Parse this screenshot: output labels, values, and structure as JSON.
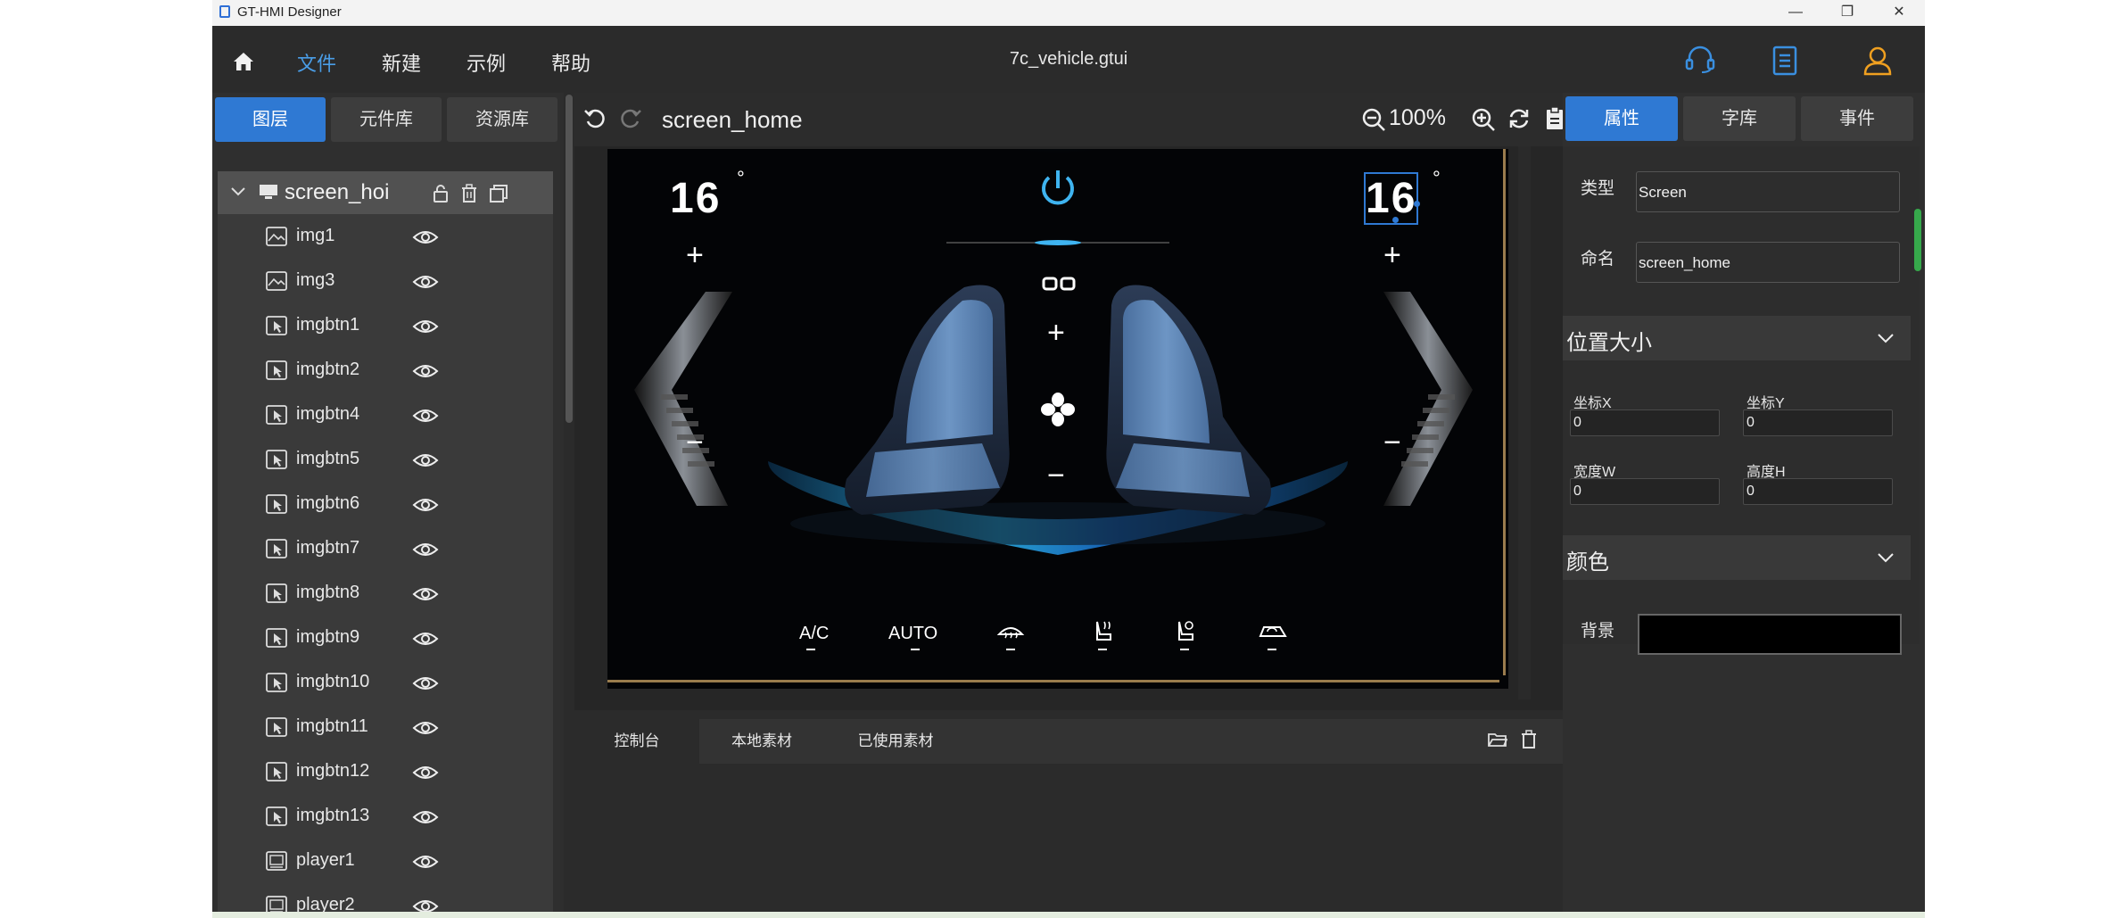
{
  "window": {
    "title": "GT-HMI Designer",
    "minimize": "—",
    "maximize": "❐",
    "close": "✕"
  },
  "menubar": {
    "home_icon": "home-icon",
    "items": [
      "文件",
      "新建",
      "示例",
      "帮助"
    ],
    "active_item": "文件",
    "filename": "7c_vehicle.gtui",
    "right_icons": [
      "headset-icon",
      "document-icon",
      "user-icon"
    ],
    "accent_color": "#4a9de6"
  },
  "left_panel": {
    "tabs": [
      "图层",
      "元件库",
      "资源库"
    ],
    "active_tab": "图层",
    "root_layer": "screen_hoi",
    "layers": [
      {
        "name": "img1",
        "type": "image"
      },
      {
        "name": "img3",
        "type": "image"
      },
      {
        "name": "imgbtn1",
        "type": "image-button"
      },
      {
        "name": "imgbtn2",
        "type": "image-button"
      },
      {
        "name": "imgbtn4",
        "type": "image-button"
      },
      {
        "name": "imgbtn5",
        "type": "image-button"
      },
      {
        "name": "imgbtn6",
        "type": "image-button"
      },
      {
        "name": "imgbtn7",
        "type": "image-button"
      },
      {
        "name": "imgbtn8",
        "type": "image-button"
      },
      {
        "name": "imgbtn9",
        "type": "image-button"
      },
      {
        "name": "imgbtn10",
        "type": "image-button"
      },
      {
        "name": "imgbtn11",
        "type": "image-button"
      },
      {
        "name": "imgbtn12",
        "type": "image-button"
      },
      {
        "name": "imgbtn13",
        "type": "image-button"
      },
      {
        "name": "player1",
        "type": "player"
      },
      {
        "name": "player2",
        "type": "player"
      }
    ]
  },
  "canvas": {
    "screen_name": "screen_home",
    "zoom": "100%",
    "hmi": {
      "left_temp": "16",
      "right_temp": "16",
      "degree": "°",
      "plus": "+",
      "minus": "−",
      "bottom_buttons": [
        "A/C",
        "AUTO",
        "defrost-icon",
        "seat-heat-icon",
        "seat-vent-icon",
        "recirculation-icon"
      ],
      "accent_color": "#3fb4f0"
    }
  },
  "console": {
    "tabs": [
      "控制台",
      "本地素材",
      "已使用素材"
    ],
    "active_tab": "控制台"
  },
  "right_panel": {
    "tabs": [
      "属性",
      "字库",
      "事件"
    ],
    "active_tab": "属性",
    "type_label": "类型",
    "type_value": "Screen",
    "name_label": "命名",
    "name_value": "screen_home",
    "position_section": "位置大小",
    "x_label": "坐标X",
    "x_value": "0",
    "y_label": "坐标Y",
    "y_value": "0",
    "w_label": "宽度W",
    "w_value": "0",
    "h_label": "高度H",
    "h_value": "0",
    "color_section": "颜色",
    "bg_label": "背景",
    "bg_value": "#000000"
  }
}
